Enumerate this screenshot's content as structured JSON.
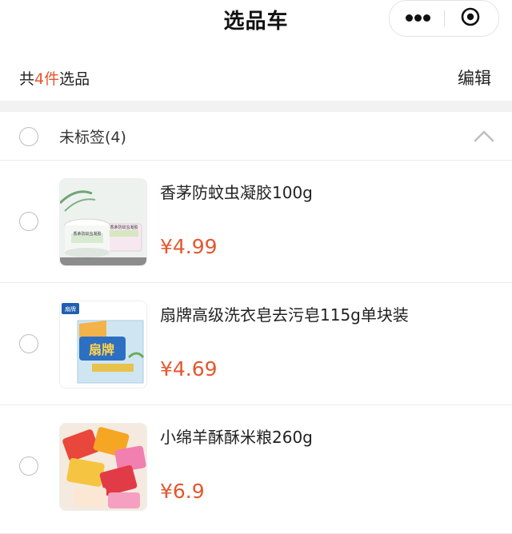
{
  "page": {
    "title": "选品车"
  },
  "summary": {
    "prefix": "共",
    "count": "4件",
    "suffix": "选品",
    "edit_label": "编辑"
  },
  "group": {
    "label": "未标签(4)"
  },
  "items": [
    {
      "title": "香茅防蚊虫凝胶100g",
      "price": "¥4.99",
      "image_icon": "mosquito-gel-product-image",
      "label_text": "香茅防蚊虫凝胶"
    },
    {
      "title": "扇牌高级洗衣皂去污皂115g单块装",
      "price": "¥4.69",
      "image_icon": "laundry-soap-product-image",
      "label_text": "扇牌"
    },
    {
      "title": "小绵羊酥酥米粮260g",
      "price": "¥6.9",
      "image_icon": "rice-cracker-snack-product-image"
    }
  ],
  "colors": {
    "accent": "#e4572e",
    "divider": "#ececec",
    "background_gap": "#f2f2f2"
  }
}
